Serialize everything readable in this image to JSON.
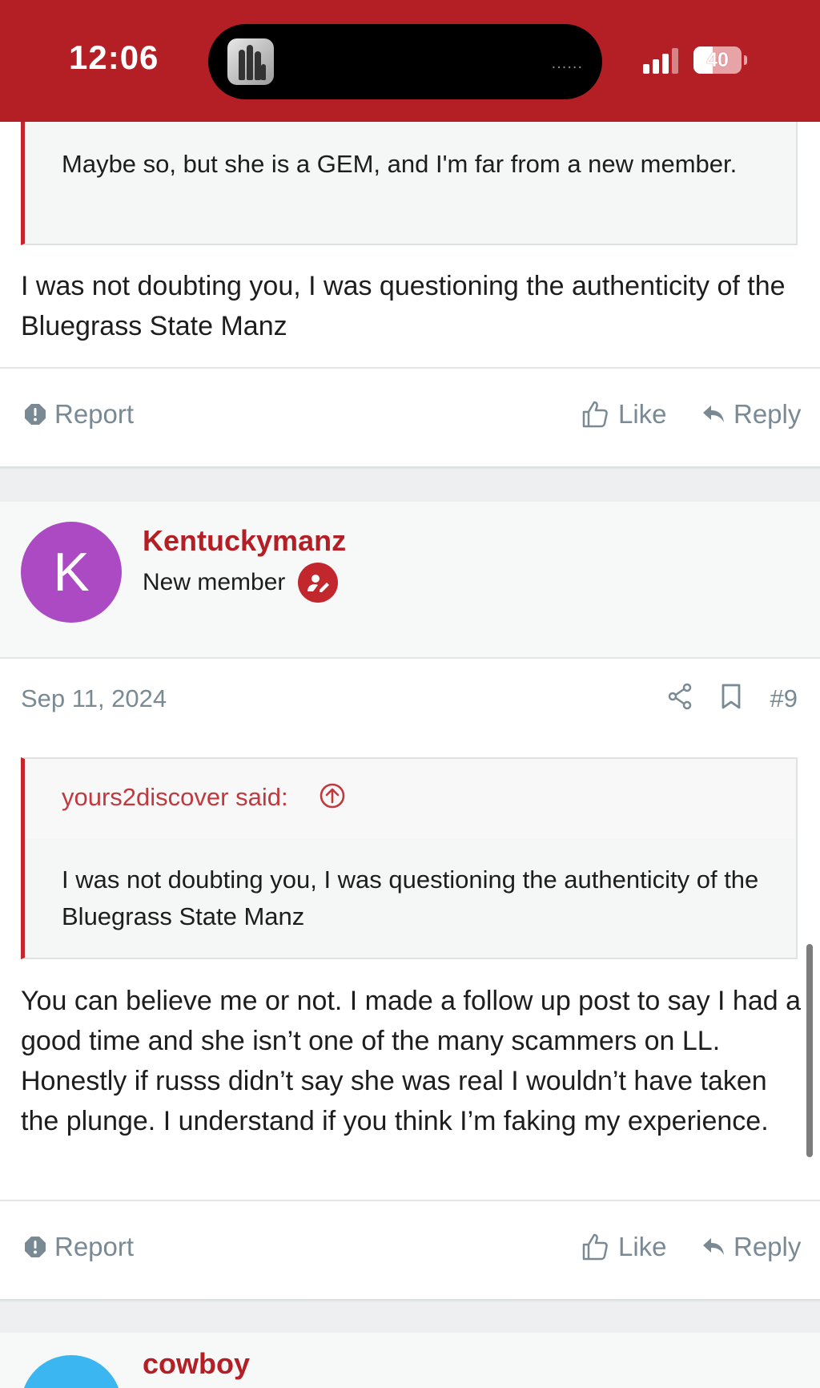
{
  "status_bar": {
    "time": "12:06",
    "battery": "40",
    "dots": "......"
  },
  "post_8": {
    "quote_text": "Maybe so, but she is a GEM, and I'm far from a new member.",
    "body": "I was not doubting you, I was questioning the authenticity of the Bluegrass State Manz",
    "report_label": "Report",
    "like_label": "Like",
    "reply_label": "Reply"
  },
  "post_9": {
    "avatar_letter": "K",
    "avatar_color": "#ab4ac3",
    "username": "Kentuckymanz",
    "user_title": "New member",
    "date": "Sep 11, 2024",
    "post_number": "#9",
    "quote_author": "yours2discover said:",
    "quote_text": "I was not doubting you, I was questioning the authenticity of the Bluegrass State Manz",
    "body": "You can believe me or not. I made a follow up post to say I had a good time and she isn’t one of the many scammers on LL. Honestly if russs didn’t say she was real I wouldn’t have taken the plunge. I understand if you think I’m faking my experience.",
    "report_label": "Report",
    "like_label": "Like",
    "reply_label": "Reply"
  },
  "post_10": {
    "avatar_color": "#3cb6f0",
    "username": "cowboy"
  },
  "colors": {
    "brand": "#b31f25",
    "muted": "#7a8a94",
    "quote_border": "#c2272d"
  }
}
